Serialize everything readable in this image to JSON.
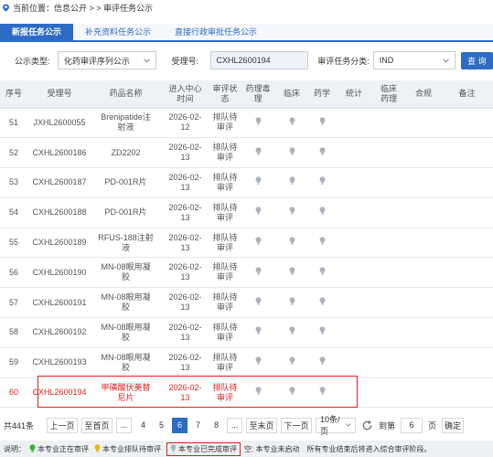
{
  "breadcrumb": {
    "prefix": "当前位置：信息公开 > > 审评任务公示"
  },
  "tabs": [
    {
      "label": "新报任务公示",
      "active": true
    },
    {
      "label": "补充资料任务公示",
      "active": false
    },
    {
      "label": "直接行政审批任务公示",
      "active": false
    }
  ],
  "filters": {
    "type_label": "公示类型:",
    "type_value": "化药审评序列公示",
    "accept_label": "受理号:",
    "accept_value": "CXHL2600194",
    "category_label": "审评任务分类:",
    "category_value": "IND",
    "search_label": "查 询"
  },
  "table": {
    "headers": [
      "序号",
      "受理号",
      "药品名称",
      "进入中心\n时间",
      "审评状\n态",
      "药理毒\n理",
      "临床",
      "药学",
      "统计",
      "临床\n药理",
      "合规",
      "备注"
    ],
    "rows": [
      {
        "no": "51",
        "accept": "JXHL2600055",
        "drug": "Brenipatide注\n射液",
        "date": "2026-02-\n12",
        "status": "排队待\n审评",
        "bulbs": [
          1,
          1,
          1
        ]
      },
      {
        "no": "52",
        "accept": "CXHL2600186",
        "drug": "ZD2202",
        "date": "2026-02-\n13",
        "status": "排队待\n审评",
        "bulbs": [
          1,
          1,
          1
        ]
      },
      {
        "no": "53",
        "accept": "CXHL2600187",
        "drug": "PD-001R片",
        "date": "2026-02-\n13",
        "status": "排队待\n审评",
        "bulbs": [
          1,
          1,
          1
        ]
      },
      {
        "no": "54",
        "accept": "CXHL2600188",
        "drug": "PD-001R片",
        "date": "2026-02-\n13",
        "status": "排队待\n审评",
        "bulbs": [
          1,
          1,
          1
        ]
      },
      {
        "no": "55",
        "accept": "CXHL2600189",
        "drug": "RFUS-188注射\n液",
        "date": "2026-02-\n13",
        "status": "排队待\n审评",
        "bulbs": [
          1,
          1,
          1
        ]
      },
      {
        "no": "56",
        "accept": "CXHL2600190",
        "drug": "MN-08眼用凝\n胶",
        "date": "2026-02-\n13",
        "status": "排队待\n审评",
        "bulbs": [
          1,
          1,
          1
        ]
      },
      {
        "no": "57",
        "accept": "CXHL2600191",
        "drug": "MN-08眼用凝\n胶",
        "date": "2026-02-\n13",
        "status": "排队待\n审评",
        "bulbs": [
          1,
          1,
          1
        ]
      },
      {
        "no": "58",
        "accept": "CXHL2600192",
        "drug": "MN-08眼用凝\n胶",
        "date": "2026-02-\n13",
        "status": "排队待\n审评",
        "bulbs": [
          1,
          1,
          1
        ]
      },
      {
        "no": "59",
        "accept": "CXHL2600193",
        "drug": "MN-08眼用凝\n胶",
        "date": "2026-02-\n13",
        "status": "排队待\n审评",
        "bulbs": [
          1,
          1,
          1
        ]
      },
      {
        "no": "60",
        "accept": "CXHL2600194",
        "drug": "甲磺酸伏美替\n尼片",
        "date": "2026-02-\n13",
        "status": "排队待\n审评",
        "bulbs": [
          1,
          1,
          1
        ],
        "highlight": true
      }
    ]
  },
  "pager": {
    "total": "共441条",
    "first": "上一页",
    "home": "至首页",
    "ellipsis1": "...",
    "pages": [
      "4",
      "5",
      "6",
      "7",
      "8"
    ],
    "current": "6",
    "ellipsis2": "...",
    "last": "至末页",
    "next": "下一页",
    "per_page": "10条/页",
    "goto_label": "到第",
    "goto_value": "6",
    "goto_unit": "页",
    "confirm": "确定"
  },
  "legend": {
    "label": "说明：",
    "item1": "本专业正在审评",
    "item2": "本专业排队待审评",
    "item3": "本专业已完成审评",
    "item4": "空: 本专业未启动",
    "note": "所有专业结束后将进入综合审评阶段。"
  },
  "colors": {
    "primary": "#2d6bc4",
    "highlight": "#e02020",
    "bulb_green": "#3aaa35",
    "bulb_yellow": "#e6b800",
    "bulb_grey": "#aab2bb"
  }
}
